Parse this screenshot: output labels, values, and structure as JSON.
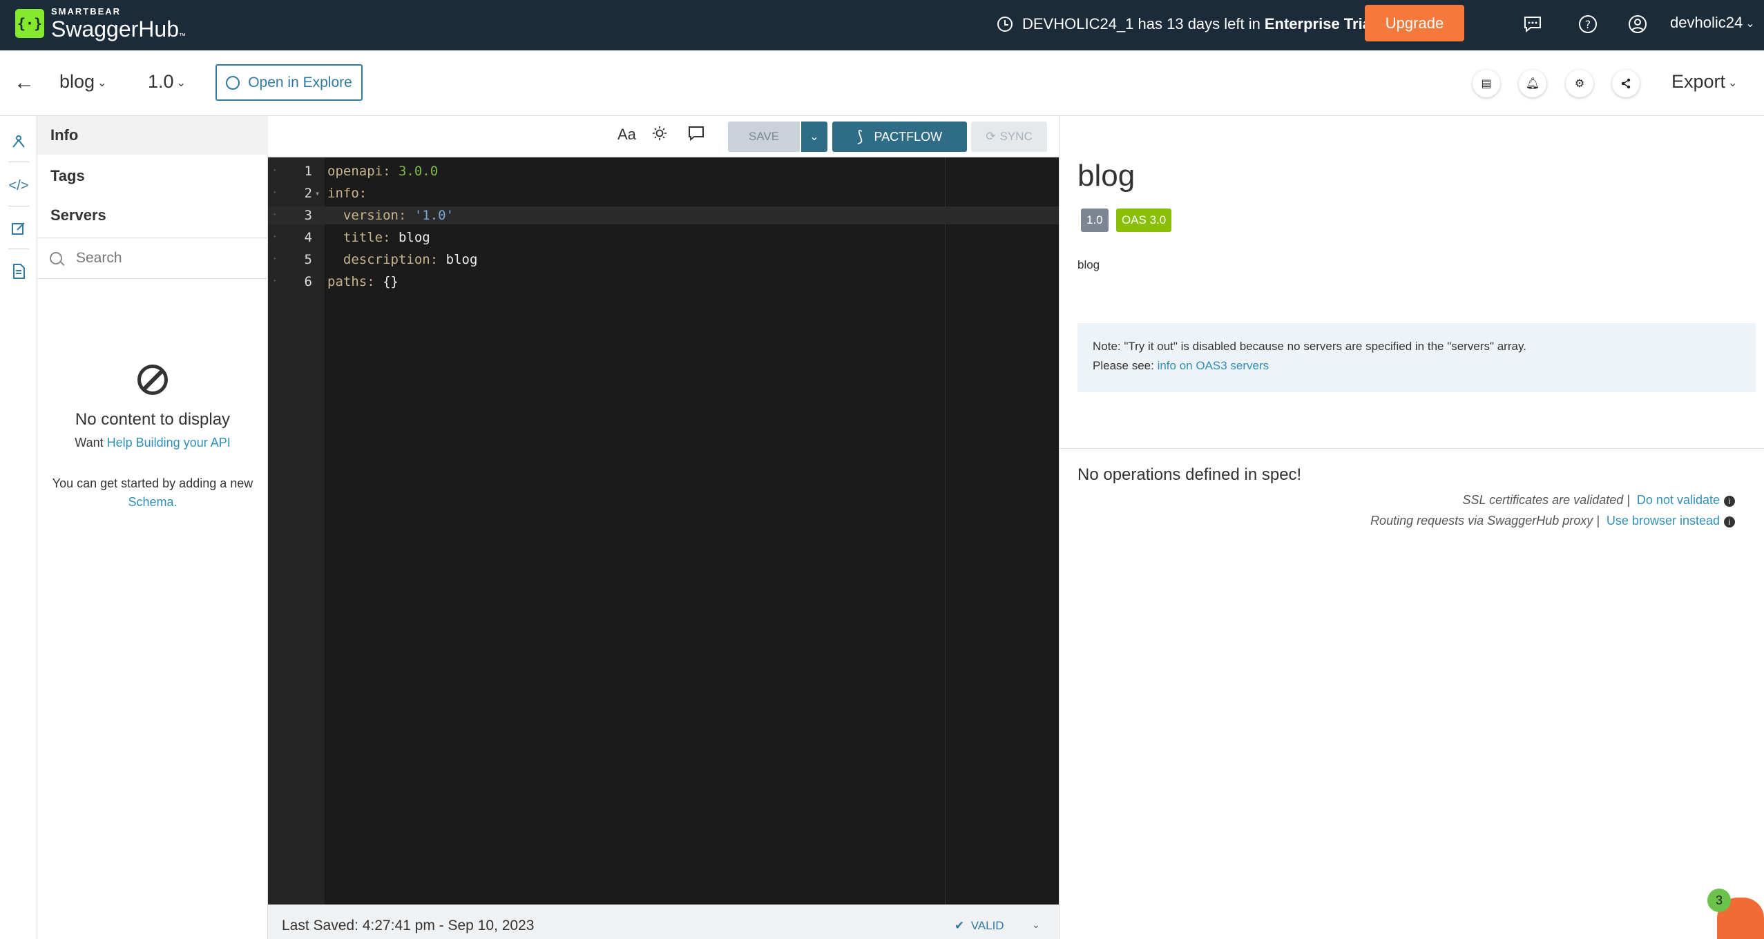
{
  "topbar": {
    "brand_small": "SMARTBEAR",
    "brand_big": "SwaggerHub",
    "brand_tm": "™",
    "trial_text": "DEVHOLIC24_1 has 13 days left in",
    "trial_bold": "Enterprise Trial",
    "upgrade_label": "Upgrade",
    "username": "devholic24"
  },
  "subbar": {
    "api_name": "blog",
    "api_version": "1.0",
    "explore_label": "Open in Explore",
    "export_label": "Export"
  },
  "nav": {
    "items": [
      {
        "label": "Info"
      },
      {
        "label": "Tags"
      },
      {
        "label": "Servers"
      }
    ],
    "search_placeholder": "Search",
    "empty_title": "No content to display",
    "empty_want": "Want",
    "empty_help_link": "Help Building your API",
    "empty_started": "You can get started by adding a new",
    "empty_schema_link": "Schema",
    "empty_period": "."
  },
  "toolbar": {
    "font_label": "Aa",
    "save_label": "SAVE",
    "pactflow_label": "PACTFLOW",
    "sync_label": "SYNC"
  },
  "editor": {
    "lines": [
      {
        "n": "1",
        "key": "openapi:",
        "val": "3.0.0",
        "type": "num",
        "indent": ""
      },
      {
        "n": "2",
        "key": "info:",
        "val": "",
        "type": "",
        "indent": ""
      },
      {
        "n": "3",
        "key": "version:",
        "val": "'1.0'",
        "type": "str",
        "indent": "  "
      },
      {
        "n": "4",
        "key": "title:",
        "val": "blog",
        "type": "txt",
        "indent": "  "
      },
      {
        "n": "5",
        "key": "description:",
        "val": "blog",
        "type": "txt",
        "indent": "  "
      },
      {
        "n": "6",
        "key": "paths:",
        "val": "{}",
        "type": "txt",
        "indent": ""
      }
    ]
  },
  "status": {
    "last_saved": "Last Saved:  4:27:41 pm   -   Sep 10, 2023",
    "valid_label": "VALID"
  },
  "preview": {
    "title": "blog",
    "version_badge": "1.0",
    "oas_badge": "OAS 3.0",
    "description": "blog",
    "note_line1": "Note: \"Try it out\" is disabled because no servers are specified in the \"servers\" array.",
    "note_please": "Please see:",
    "note_link": "info on OAS3 servers",
    "no_ops": "No operations defined in spec!",
    "ssl_text": "SSL certificates are validated |",
    "ssl_link": "Do not validate",
    "proxy_text": "Routing requests via SwaggerHub proxy |",
    "proxy_link": "Use browser instead"
  },
  "notification_count": "3",
  "colors": {
    "topbar": "#1b2b3a",
    "accent": "#2f7a9e",
    "upgrade": "#f5793a",
    "oas_badge": "#89bf04",
    "version_badge": "#7d8492"
  }
}
